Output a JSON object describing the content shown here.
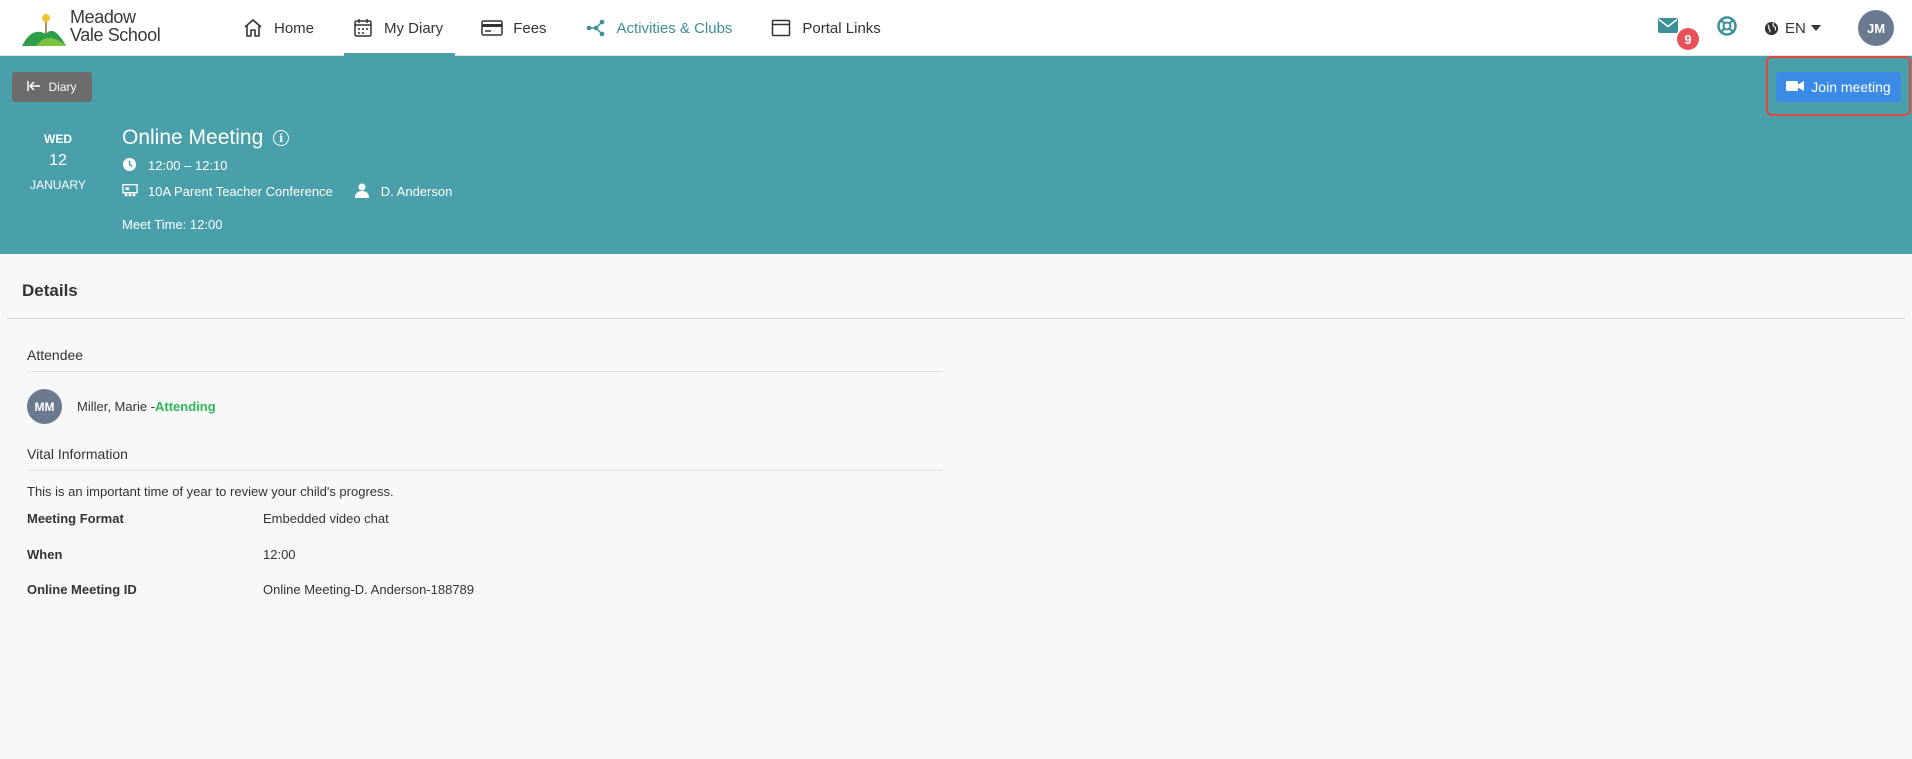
{
  "app": {
    "logo_line1": "Meadow",
    "logo_line2": "Vale School"
  },
  "nav": {
    "items": [
      {
        "label": "Home",
        "icon": "home-icon"
      },
      {
        "label": "My Diary",
        "icon": "calendar-icon"
      },
      {
        "label": "Fees",
        "icon": "card-icon"
      },
      {
        "label": "Activities & Clubs",
        "icon": "network-icon"
      },
      {
        "label": "Portal Links",
        "icon": "window-icon"
      }
    ],
    "active": "My Diary"
  },
  "header_right": {
    "mail_count": "9",
    "language": "EN",
    "user_initials": "JM"
  },
  "event": {
    "back_label": "Diary",
    "join_label": "Join meeting",
    "date_dow": "WED",
    "date_day": "12",
    "date_month": "JANUARY",
    "title": "Online Meeting",
    "time": "12:00 – 12:10",
    "venue": "10A Parent Teacher Conference",
    "teacher": "D. Anderson",
    "meet_time": "Meet Time: 12:00"
  },
  "details": {
    "title": "Details",
    "attendee_section": "Attendee",
    "attendee_initials": "MM",
    "attendee_name": "Miller, Marie - ",
    "attendee_status": "Attending",
    "vital_section": "Vital Information",
    "vital_text": "This is an important time of year to review your child's progress.",
    "rows": [
      {
        "key": "Meeting Format",
        "value": "Embedded video chat"
      },
      {
        "key": "When",
        "value": "12:00"
      },
      {
        "key": "Online Meeting ID",
        "value": "Online Meeting-D. Anderson-188789"
      }
    ]
  },
  "colors": {
    "teal": "#4aa0aa",
    "join_blue": "#3b8ae6",
    "badge_red": "#e8505b",
    "attending_green": "#2eb85c",
    "highlight_red": "#e3463c"
  }
}
